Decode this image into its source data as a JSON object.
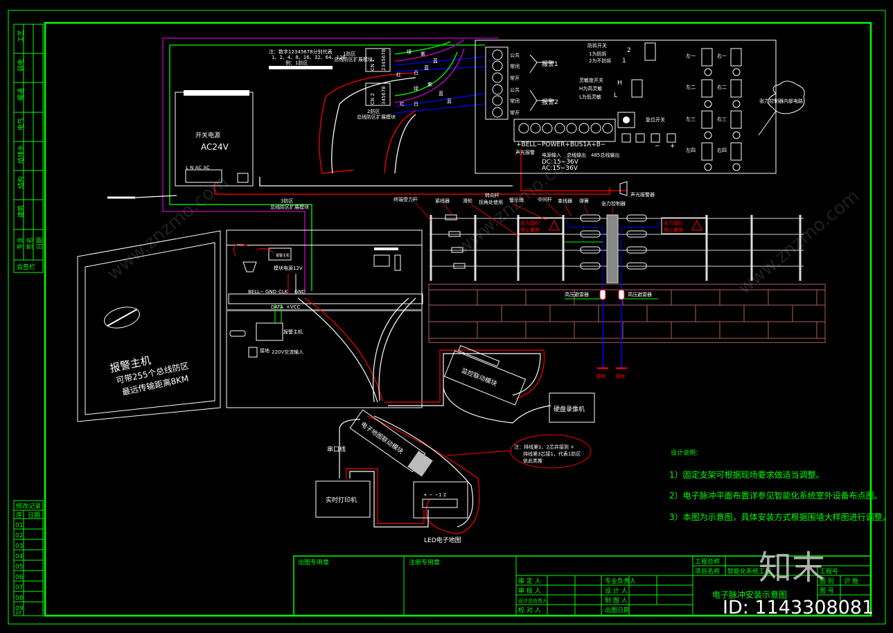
{
  "colors": {
    "frame": "#00ff00",
    "wire_red": "#ff0000",
    "wire_blue": "#0000ff",
    "wire_green": "#00ff00",
    "wire_purple": "#cc00cc",
    "wall": "#b06060",
    "line": "#ffffff"
  },
  "side_strip": {
    "disciplines": [
      "工艺",
      "弱电",
      "暖通",
      "电气",
      "给排水",
      "结构",
      "建筑"
    ],
    "header": [
      "专业",
      "签名",
      "签名",
      "日期"
    ],
    "footer": "会签栏"
  },
  "revision": {
    "title": "修改记录",
    "cols": [
      "序",
      "日期"
    ],
    "rows": [
      "01",
      "02",
      "03",
      "04",
      "05",
      "06",
      "07",
      "08",
      "09",
      "10"
    ]
  },
  "power": {
    "title": "开关电源",
    "voltage": "AC24V",
    "terminals": "L  N   AC AC"
  },
  "note_top": {
    "line1": "注：数字12345678分别代表",
    "line2": "1、2、4、8、16、32、64、128",
    "line3": "例：1防区"
  },
  "modules": [
    {
      "zone": "1防区",
      "name": "总线防区扩展模块",
      "cn": "CN 1",
      "pins": "2345678"
    },
    {
      "zone": "2防区",
      "name": "总线防区扩展模块",
      "cn": "CN 2",
      "pins": "345678"
    }
  ],
  "module3": {
    "zone": "3防区",
    "name": "总线防区扩展模块"
  },
  "wire_labels": [
    "绿",
    "紫",
    "蓝",
    "蓝",
    "红",
    "白",
    "绿",
    "紫",
    "蓝",
    "蓝",
    "红",
    "白"
  ],
  "board": {
    "relay_labels": [
      "公共",
      "常闭",
      "常开",
      "公共",
      "常闭",
      "常开"
    ],
    "alarm1": "报警1",
    "alarm2": "报警2",
    "tamper": {
      "title": "防拆开关",
      "l1": "1为防拆",
      "l2": "2为不防拆",
      "n2": "2",
      "n1": "1"
    },
    "sens": {
      "title": "灵敏度开关",
      "l1": "H为高灵敏",
      "l2": "L为低灵敏",
      "h": "H",
      "l": "L"
    },
    "reset": "复位开关",
    "terminal_row": "+BELL−POWER+BUS1A+B−",
    "bell": "声光报警",
    "power_in": "电源输入",
    "dc": "DC:15−36V",
    "ac": "AC:15−36V",
    "bus_out": "总线输出",
    "rs485": "485总线输出",
    "minus": "−",
    "plus": "+",
    "channels": [
      "左一",
      "右一",
      "左二",
      "右二",
      "左三",
      "右三",
      "左四",
      "右四"
    ],
    "cloud": "张力控制器内部电路"
  },
  "siren": "声光报警器",
  "fence": {
    "labels": [
      "终端受力杆",
      "紧线器",
      "滑轮",
      "转向杆",
      "拐角处使用",
      "警示牌",
      "中间杆",
      "束线器",
      "弹簧",
      "张力控制器"
    ],
    "sign1": "张力围栏",
    "sign2": "禁止攀爬",
    "arrester": "高压避雷器",
    "ground": "接地"
  },
  "host_box": {
    "l1": "报警主机",
    "l2": "可带255个总线防区",
    "l3": "最远传输距离8KM"
  },
  "cabinet": {
    "psu12": "模块电源12V",
    "keypad": "报警主机",
    "ac220": "220V交流输入",
    "data": "DATA",
    "vcc": "+VCC",
    "bell": "BELL−",
    "gnd": "GND",
    "clk": "CLK",
    "l": "L",
    "e": "接地",
    "n": "N"
  },
  "bottom": {
    "serial": "串口线",
    "printer": "实时打印机",
    "led_map": "LED电子地图",
    "map_module": "电子地图联动模块",
    "cctv_module": "监控联动模块",
    "dvr": "硬盘录像机",
    "note1": "注：排线第1、2芯并接到 +",
    "note2": "排线第3芯接1，代表1防区",
    "note3": "依此类推",
    "led_terms": "+  −  −1  2"
  },
  "design_notes": {
    "title": "设计说明：",
    "items": [
      "1）固定支架可根据现场要求做适当调整。",
      "2）电子脉冲平面布置详参见智能化系统室外设备布点图。",
      "3）本图为示意图，具体安装方式根据围墙大样图进行调整。"
    ]
  },
  "title_block": {
    "stamp1": "出图专用章",
    "stamp2": "注册专用章",
    "left": [
      "审 定 人",
      "审 核 人",
      "设计总负责人",
      "校 对 人"
    ],
    "mid": [
      "专业负责人",
      "设 计 人",
      "制 图 人",
      "出图日期"
    ],
    "project_total": "工程总称",
    "project_name_label": "项目名称",
    "project_name": "智能化系统工程",
    "project_no": "工程号",
    "drawing_type_label": "图 别",
    "drawing_type": "识 施",
    "drawing_no": "图 号",
    "drawing_title": "电子脉冲安装示意图"
  },
  "watermark": {
    "logo": "知末",
    "id": "ID: 1143308081",
    "site": "www.znzmo.com"
  }
}
